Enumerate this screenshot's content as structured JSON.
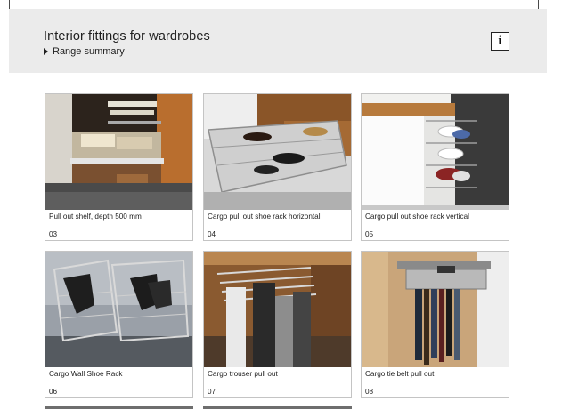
{
  "header": {
    "title": "Interior fittings for wardrobes",
    "breadcrumb": "Range summary",
    "info_label": "i"
  },
  "products": [
    {
      "name": "Pull out shelf, depth 500 mm",
      "number": "03",
      "image": "pull-out-shelf-photo"
    },
    {
      "name": "Cargo pull out shoe rack horizontal",
      "number": "04",
      "image": "shoe-rack-horizontal-photo"
    },
    {
      "name": "Cargo pull out shoe rack vertical",
      "number": "05",
      "image": "shoe-rack-vertical-photo"
    },
    {
      "name": "Cargo Wall Shoe Rack",
      "number": "06",
      "image": "wall-shoe-rack-photo"
    },
    {
      "name": "Cargo trouser pull out",
      "number": "07",
      "image": "trouser-pull-out-photo"
    },
    {
      "name": "Cargo tie belt pull out",
      "number": "08",
      "image": "tie-belt-pull-out-photo"
    }
  ]
}
